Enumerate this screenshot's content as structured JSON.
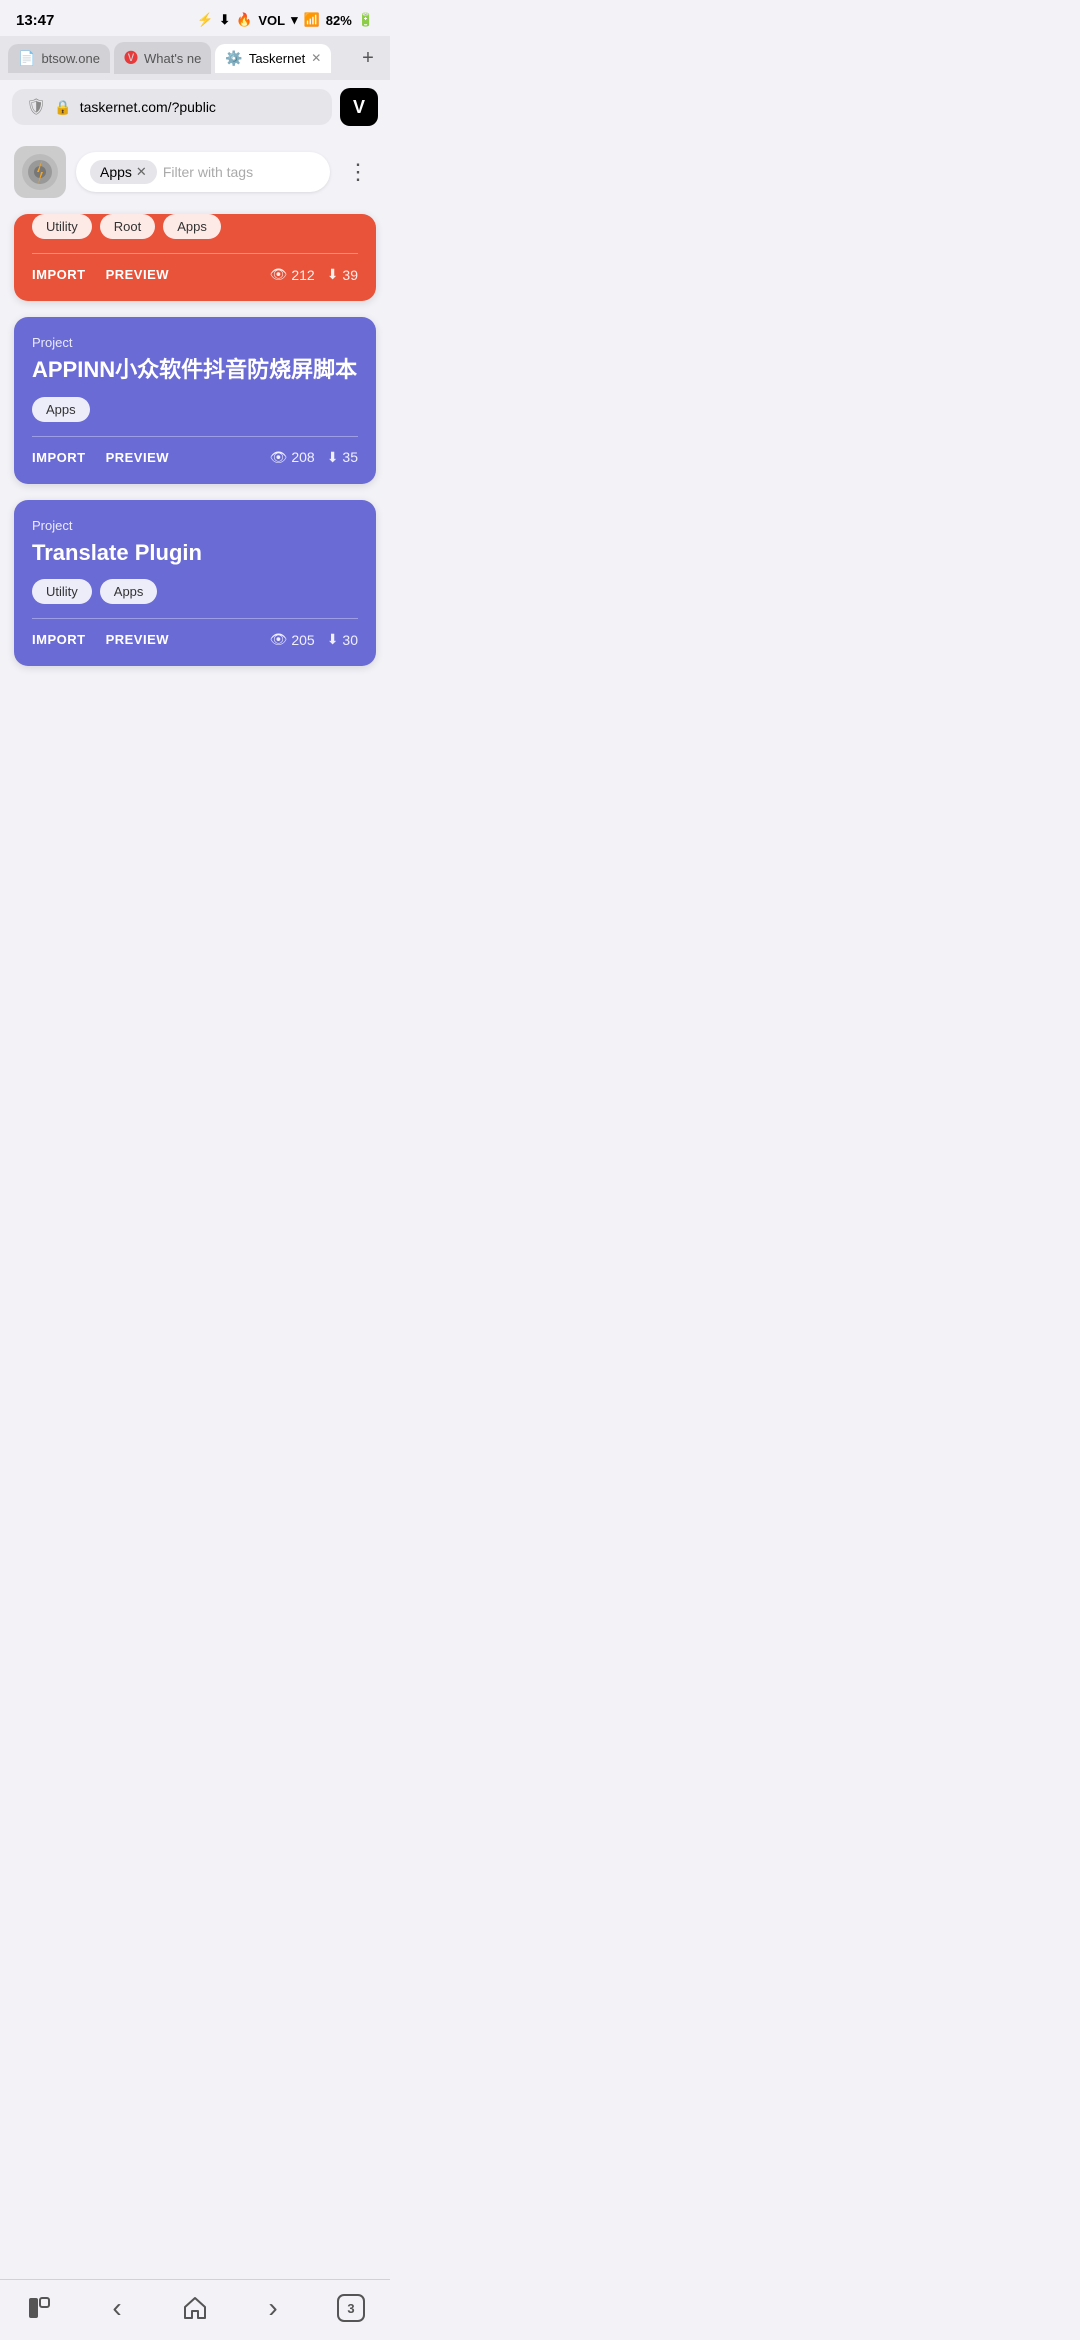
{
  "statusBar": {
    "time": "13:47",
    "batteryLevel": "82%",
    "icons": [
      "⚡",
      "⬇",
      "🔥",
      "📊"
    ]
  },
  "browser": {
    "tabs": [
      {
        "id": "tab1",
        "label": "btsow.one",
        "icon": "📄",
        "active": false
      },
      {
        "id": "tab2",
        "label": "What's ne",
        "icon": "🅥",
        "active": false
      },
      {
        "id": "tab3",
        "label": "Taskernet",
        "icon": "⚙",
        "active": true
      }
    ],
    "addTab": "+",
    "addressBar": {
      "url": "taskernet.com/?public",
      "shieldIcon": "🛡",
      "lockIcon": "🔒"
    },
    "vivaldiBtnLabel": "V"
  },
  "filterBar": {
    "logoIcon": "⚙️",
    "activeTag": "Apps",
    "placeholder": "Filter with tags",
    "moreIcon": "⋮"
  },
  "partialCard": {
    "tags": [
      "Utility",
      "Root",
      "Apps"
    ],
    "importLabel": "IMPORT",
    "previewLabel": "PREVIEW",
    "views": "212",
    "downloads": "39"
  },
  "cards": [
    {
      "type": "Project",
      "title": "APPINN小众软件抖音防烧屏脚本",
      "tags": [
        "Apps"
      ],
      "importLabel": "IMPORT",
      "previewLabel": "PREVIEW",
      "views": "208",
      "downloads": "35",
      "color": "purple"
    },
    {
      "type": "Project",
      "title": "Translate Plugin",
      "tags": [
        "Utility",
        "Apps"
      ],
      "importLabel": "IMPORT",
      "previewLabel": "PREVIEW",
      "views": "205",
      "downloads": "30",
      "color": "purple"
    }
  ],
  "bottomNav": {
    "squareIcon": "▪",
    "backIcon": "‹",
    "homeIcon": "⌂",
    "forwardIcon": "›",
    "tabCountLabel": "3"
  }
}
